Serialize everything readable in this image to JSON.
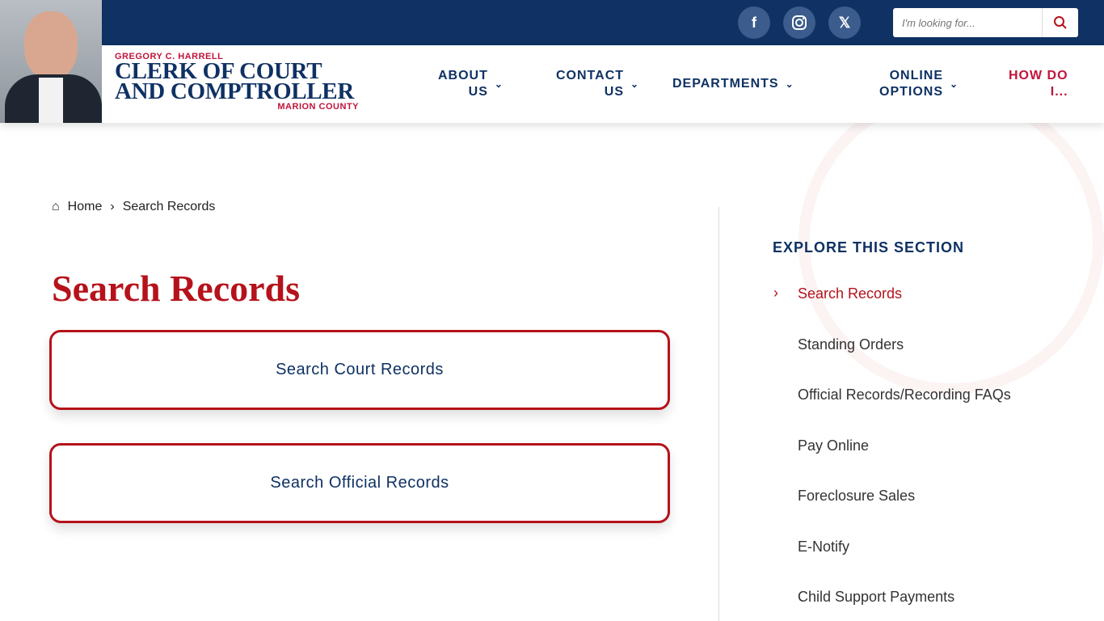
{
  "header": {
    "logo": {
      "name": "GREGORY C. HARRELL",
      "title_line1": "CLERK OF COURT",
      "title_line2": "AND COMPTROLLER",
      "county": "MARION COUNTY"
    },
    "nav": [
      {
        "line1": "ABOUT",
        "line2": "US"
      },
      {
        "line1": "CONTACT",
        "line2": "US"
      },
      {
        "line1": "DEPARTMENTS",
        "line2": ""
      },
      {
        "line1": "ONLINE",
        "line2": "OPTIONS"
      },
      {
        "line1": "HOW DO",
        "line2": "I..."
      }
    ],
    "social": [
      "facebook-icon",
      "instagram-icon",
      "x-icon"
    ],
    "search": {
      "placeholder": "I'm looking for..."
    }
  },
  "breadcrumb": {
    "home": "Home",
    "current": "Search Records"
  },
  "main": {
    "title": "Search Records",
    "cards": [
      "Search Court Records",
      "Search Official Records"
    ]
  },
  "sidebar": {
    "heading": "EXPLORE THIS SECTION",
    "items": [
      "Search Records",
      "Standing Orders",
      "Official Records/Recording FAQs",
      "Pay Online",
      "Foreclosure Sales",
      "E-Notify",
      "Child Support Payments"
    ]
  },
  "colors": {
    "navy": "#0f3163",
    "red": "#b5121b"
  }
}
